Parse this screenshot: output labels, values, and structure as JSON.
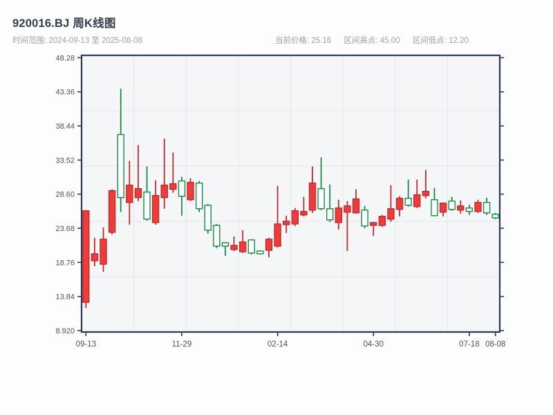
{
  "header": {
    "title": "920016.BJ 周K线图",
    "subtitle": "时间范围: 2024-09-13 至 2025-08-08",
    "stats": [
      "当前价格: 25.16",
      "区间高点: 45.00",
      "区间低点: 12.20"
    ]
  },
  "chart_data": {
    "type": "candlestick",
    "title": "920016.BJ 周K线图",
    "symbol": "920016.BJ",
    "period": "weekly",
    "date_range": {
      "start": "2024-09-13",
      "end": "2025-08-08"
    },
    "current_price": 25.16,
    "range_high": 45.0,
    "range_low": 12.2,
    "y_tick_labels": [
      "48.28",
      "43.36",
      "38.44",
      "33.52",
      "28.60",
      "23.68",
      "18.76",
      "13.84",
      "8.920"
    ],
    "y_axis_drawn_range": [
      8.72,
      48.62
    ],
    "x_tick_labels": [
      "09-13",
      "11-29",
      "02-14",
      "04-30",
      "07-18",
      "08-08"
    ],
    "x_tick_candle_indices": [
      0,
      11,
      22,
      33,
      44,
      47
    ],
    "grid": {
      "vertical_divisions": 8,
      "horizontal_divisions": 5,
      "color": "#e6e8ec"
    },
    "colors": {
      "up_fill": "#ee3b3b",
      "up_stroke": "#bf2c2c",
      "down_stroke": "#178c42",
      "down_fill": "#fcfdfe",
      "spine": "#2c3a50",
      "tick_text": "#46525f",
      "plot_bg": "#f4f6f8"
    },
    "candle_columns": [
      "open",
      "high",
      "low",
      "close"
    ],
    "candles": [
      [
        13.0,
        26.3,
        12.2,
        26.2
      ],
      [
        19.0,
        22.3,
        18.2,
        20.0
      ],
      [
        18.5,
        23.8,
        17.4,
        22.1
      ],
      [
        23.1,
        29.3,
        22.8,
        29.1
      ],
      [
        37.2,
        43.8,
        26.0,
        28.1
      ],
      [
        27.4,
        33.4,
        24.2,
        29.9
      ],
      [
        28.1,
        35.7,
        27.6,
        29.4
      ],
      [
        28.9,
        32.6,
        24.8,
        25.0
      ],
      [
        24.5,
        30.6,
        24.2,
        28.4
      ],
      [
        28.1,
        36.6,
        26.5,
        29.9
      ],
      [
        29.3,
        34.6,
        28.8,
        30.1
      ],
      [
        30.5,
        31.1,
        25.5,
        28.3
      ],
      [
        27.8,
        30.9,
        27.6,
        30.3
      ],
      [
        30.2,
        30.5,
        26.0,
        26.5
      ],
      [
        27.0,
        27.2,
        22.9,
        23.4
      ],
      [
        24.1,
        24.3,
        20.8,
        21.1
      ],
      [
        21.6,
        21.7,
        19.7,
        21.1
      ],
      [
        20.6,
        22.5,
        20.4,
        21.2
      ],
      [
        20.3,
        23.4,
        20.1,
        21.7
      ],
      [
        22.0,
        22.1,
        19.9,
        20.1
      ],
      [
        20.4,
        20.5,
        19.9,
        20.0
      ],
      [
        20.5,
        22.3,
        19.5,
        22.1
      ],
      [
        21.1,
        29.8,
        20.9,
        24.3
      ],
      [
        24.2,
        25.5,
        23.0,
        24.7
      ],
      [
        24.3,
        26.6,
        24.0,
        26.2
      ],
      [
        25.6,
        28.2,
        25.4,
        26.1
      ],
      [
        26.3,
        32.6,
        25.9,
        30.2
      ],
      [
        29.4,
        33.9,
        26.3,
        26.5
      ],
      [
        26.5,
        30.0,
        24.6,
        24.9
      ],
      [
        24.5,
        27.8,
        23.5,
        26.6
      ],
      [
        26.0,
        27.6,
        20.4,
        26.9
      ],
      [
        25.9,
        29.3,
        25.8,
        27.9
      ],
      [
        26.3,
        26.9,
        23.7,
        24.0
      ],
      [
        24.1,
        24.6,
        22.6,
        24.5
      ],
      [
        24.1,
        25.6,
        23.9,
        25.4
      ],
      [
        25.0,
        29.9,
        24.6,
        26.5
      ],
      [
        26.4,
        28.3,
        25.4,
        28.0
      ],
      [
        28.0,
        30.7,
        26.8,
        27.0
      ],
      [
        26.8,
        30.7,
        26.6,
        28.5
      ],
      [
        28.4,
        32.1,
        28.0,
        29.0
      ],
      [
        27.8,
        29.5,
        25.4,
        25.5
      ],
      [
        26.0,
        27.4,
        25.4,
        27.3
      ],
      [
        27.6,
        28.2,
        26.2,
        26.4
      ],
      [
        26.3,
        27.7,
        25.8,
        26.9
      ],
      [
        26.6,
        27.1,
        25.6,
        26.1
      ],
      [
        26.1,
        27.8,
        25.9,
        27.4
      ],
      [
        27.4,
        28.1,
        25.6,
        25.9
      ],
      [
        25.7,
        25.9,
        25.0,
        25.16
      ]
    ]
  }
}
